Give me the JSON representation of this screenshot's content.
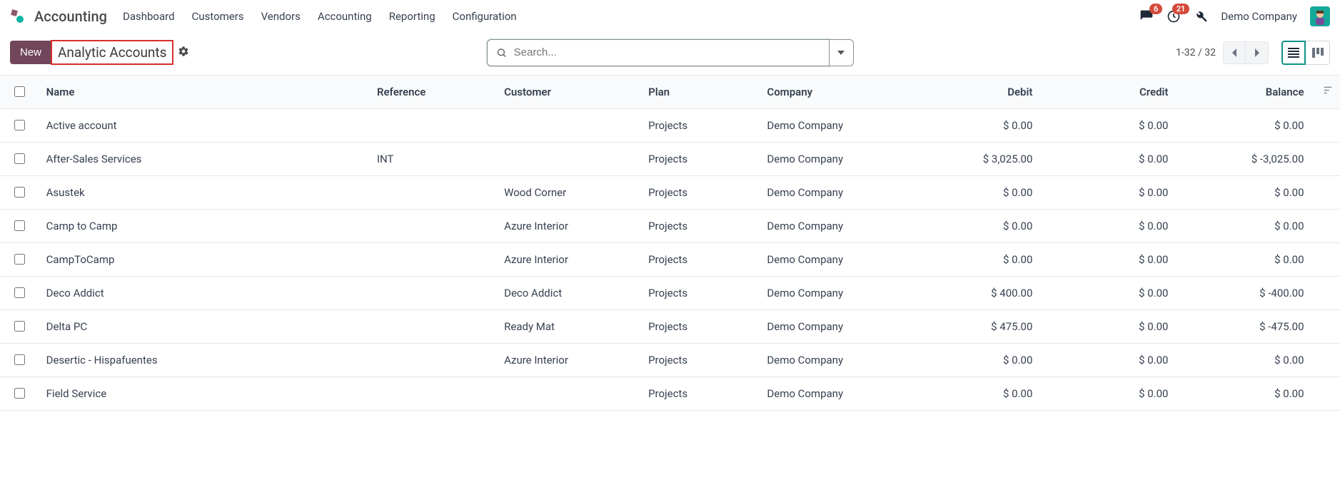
{
  "header": {
    "app_name": "Accounting",
    "menu": [
      "Dashboard",
      "Customers",
      "Vendors",
      "Accounting",
      "Reporting",
      "Configuration"
    ],
    "messages_badge": "6",
    "activities_badge": "21",
    "company_name": "Demo Company"
  },
  "control_panel": {
    "new_label": "New",
    "breadcrumb_title": "Analytic Accounts",
    "search_placeholder": "Search...",
    "pager_text": "1-32 / 32"
  },
  "table": {
    "headers": {
      "name": "Name",
      "reference": "Reference",
      "customer": "Customer",
      "plan": "Plan",
      "company": "Company",
      "debit": "Debit",
      "credit": "Credit",
      "balance": "Balance"
    },
    "rows": [
      {
        "name": "Active account",
        "reference": "",
        "customer": "",
        "plan": "Projects",
        "company": "Demo Company",
        "debit": "$ 0.00",
        "credit": "$ 0.00",
        "balance": "$ 0.00"
      },
      {
        "name": "After-Sales Services",
        "reference": "INT",
        "customer": "",
        "plan": "Projects",
        "company": "Demo Company",
        "debit": "$ 3,025.00",
        "credit": "$ 0.00",
        "balance": "$ -3,025.00"
      },
      {
        "name": "Asustek",
        "reference": "",
        "customer": "Wood Corner",
        "plan": "Projects",
        "company": "Demo Company",
        "debit": "$ 0.00",
        "credit": "$ 0.00",
        "balance": "$ 0.00"
      },
      {
        "name": "Camp to Camp",
        "reference": "",
        "customer": "Azure Interior",
        "plan": "Projects",
        "company": "Demo Company",
        "debit": "$ 0.00",
        "credit": "$ 0.00",
        "balance": "$ 0.00"
      },
      {
        "name": "CampToCamp",
        "reference": "",
        "customer": "Azure Interior",
        "plan": "Projects",
        "company": "Demo Company",
        "debit": "$ 0.00",
        "credit": "$ 0.00",
        "balance": "$ 0.00"
      },
      {
        "name": "Deco Addict",
        "reference": "",
        "customer": "Deco Addict",
        "plan": "Projects",
        "company": "Demo Company",
        "debit": "$ 400.00",
        "credit": "$ 0.00",
        "balance": "$ -400.00"
      },
      {
        "name": "Delta PC",
        "reference": "",
        "customer": "Ready Mat",
        "plan": "Projects",
        "company": "Demo Company",
        "debit": "$ 475.00",
        "credit": "$ 0.00",
        "balance": "$ -475.00"
      },
      {
        "name": "Desertic - Hispafuentes",
        "reference": "",
        "customer": "Azure Interior",
        "plan": "Projects",
        "company": "Demo Company",
        "debit": "$ 0.00",
        "credit": "$ 0.00",
        "balance": "$ 0.00"
      },
      {
        "name": "Field Service",
        "reference": "",
        "customer": "",
        "plan": "Projects",
        "company": "Demo Company",
        "debit": "$ 0.00",
        "credit": "$ 0.00",
        "balance": "$ 0.00"
      }
    ]
  }
}
